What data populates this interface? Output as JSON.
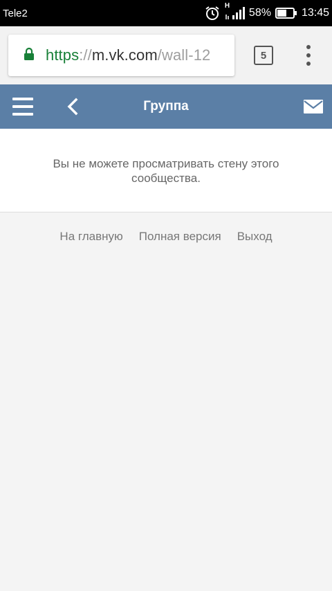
{
  "status_bar": {
    "carrier": "Tele2",
    "network_type": "H",
    "battery_percent": "58%",
    "time": "13:45",
    "icons": [
      "alarm-icon",
      "signal-icon",
      "battery-icon"
    ]
  },
  "browser": {
    "url_scheme": "https",
    "url_separator": "://",
    "url_host": "m.vk.com",
    "url_path": "/wall-12",
    "tab_count": "5",
    "colors": {
      "secure_green": "#188038",
      "toolbar_bg": "#f2f2f2"
    }
  },
  "header": {
    "title": "Группа",
    "background": "#5b7fa6",
    "icons": [
      "hamburger-icon",
      "back-arrow-icon",
      "mail-icon"
    ]
  },
  "message": {
    "text": "Вы не можете просматривать стену этого сообщества."
  },
  "footer": {
    "links": [
      {
        "label": "На главную"
      },
      {
        "label": "Полная версия"
      },
      {
        "label": "Выход"
      }
    ]
  }
}
